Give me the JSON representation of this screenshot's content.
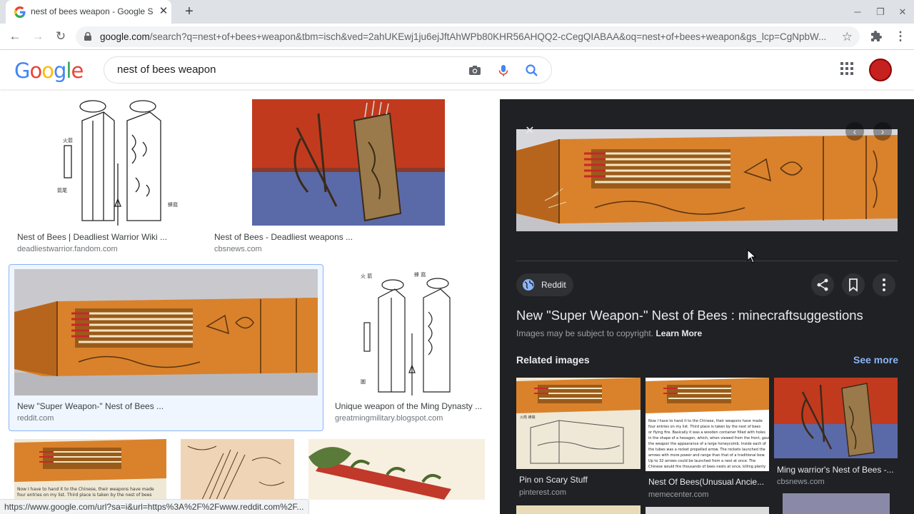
{
  "browser": {
    "tab_title": "nest of bees weapon - Google Se",
    "url_host": "google.com",
    "url_rest": "/search?q=nest+of+bees+weapon&tbm=isch&ved=2ahUKEwj1ju6ejJftAhWPb80KHR56AHQQ2-cCegQIABAA&oq=nest+of+bees+weapon&gs_lcp=CgNpbW...",
    "status_url": "https://www.google.com/url?sa=i&url=https%3A%2F%2Fwww.reddit.com%2F..."
  },
  "search": {
    "logo": "Google",
    "query": "nest of bees weapon"
  },
  "results": [
    {
      "title": "Nest of Bees | Deadliest Warrior Wiki ...",
      "source": "deadliestwarrior.fandom.com"
    },
    {
      "title": "Nest of Bees - Deadliest weapons ...",
      "source": "cbsnews.com"
    },
    {
      "title": "New \"Super Weapon-\" Nest of Bees ...",
      "source": "reddit.com"
    },
    {
      "title": "Unique weapon of the Ming Dynasty ...",
      "source": "greatmingmilitary.blogspot.com"
    }
  ],
  "preview": {
    "source_chip": "Reddit",
    "title": "New \"Super Weapon-\" Nest of Bees : minecraftsuggestions",
    "copyright": "Images may be subject to copyright.",
    "learn_more": "Learn More",
    "related_heading": "Related images",
    "see_more": "See more",
    "related": [
      {
        "title": "Pin on Scary Stuff",
        "source": "pinterest.com"
      },
      {
        "title": "Nest Of Bees(Unusual Ancie...",
        "source": "memecenter.com"
      },
      {
        "title": "Ming warrior's Nest of Bees -...",
        "source": "cbsnews.com"
      }
    ]
  },
  "colors": {
    "panel_bg": "#202124",
    "link_blue": "#8ab4f8",
    "tube_orange": "#d9822b"
  }
}
